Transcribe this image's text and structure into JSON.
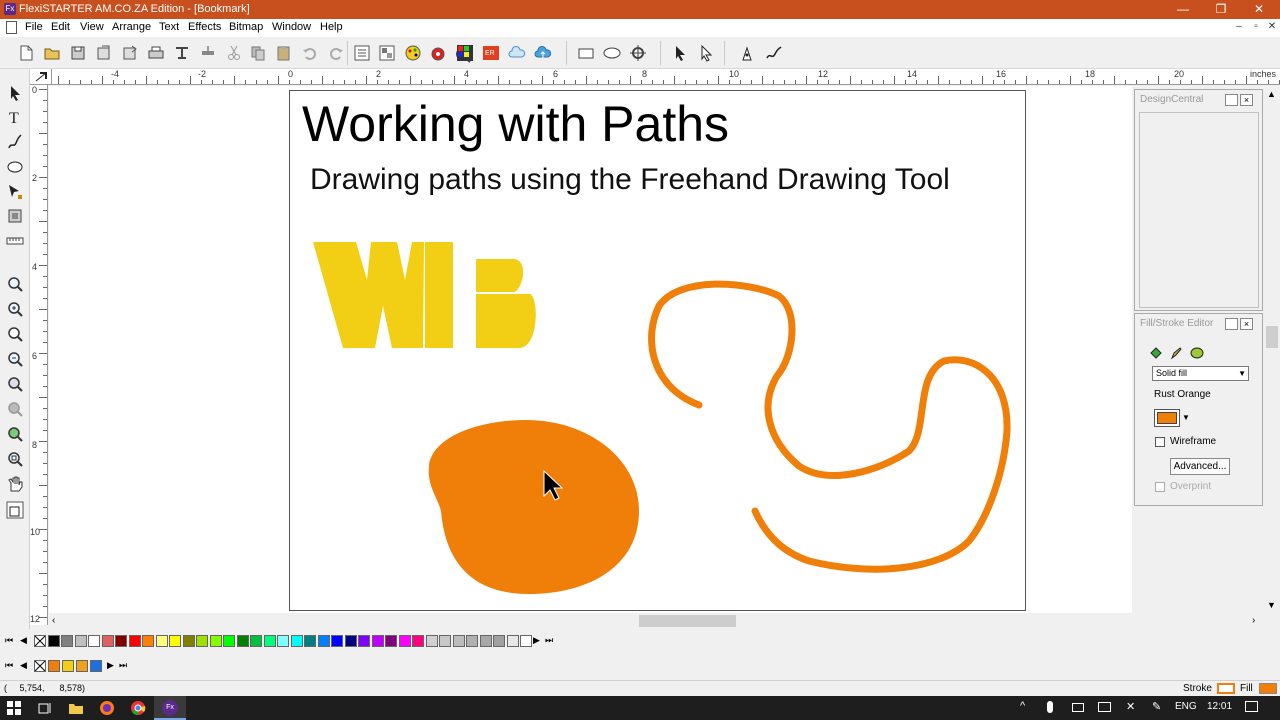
{
  "window": {
    "title": "FlexiSTARTER AM.CO.ZA Edition - [Bookmark]",
    "app_icon_text": "Fx",
    "minimize": "—",
    "restore": "❐",
    "close": "✕"
  },
  "menu": {
    "items": [
      "File",
      "Edit",
      "View",
      "Arrange",
      "Text",
      "Effects",
      "Bitmap",
      "Window",
      "Help"
    ],
    "mdi_minimize": "–",
    "mdi_restore": "▫",
    "mdi_close": "✕"
  },
  "ruler": {
    "units": "inches",
    "h_labels": [
      "-4",
      "-2",
      "0",
      "2",
      "4",
      "6",
      "8",
      "10",
      "12",
      "14",
      "16",
      "18",
      "20"
    ],
    "v_labels": [
      "0",
      "2",
      "4",
      "6",
      "8",
      "10",
      "12"
    ]
  },
  "document": {
    "heading": "Working with Paths",
    "subheading": "Drawing paths using the Freehand Drawing Tool",
    "logo_letters": "WB"
  },
  "colors": {
    "title_bar": "#c8501e",
    "rust_orange": "#f07f0a",
    "logo_yellow": "#f2ce14",
    "taskbar": "#1e1e1e"
  },
  "design_central": {
    "title": "DesignCentral",
    "close": "×"
  },
  "fill_stroke": {
    "title": "Fill/Stroke Editor",
    "close": "×",
    "fill_type": "Solid fill",
    "color_name": "Rust Orange",
    "wireframe_label": "Wireframe",
    "advanced_label": "Advanced...",
    "overprint_label": "Overprint"
  },
  "status": {
    "coords": "(     5,754,      8,578)",
    "stroke_label": "Stroke",
    "fill_label": "Fill"
  },
  "taskbar": {
    "lang": "ENG",
    "time": "12:01"
  }
}
